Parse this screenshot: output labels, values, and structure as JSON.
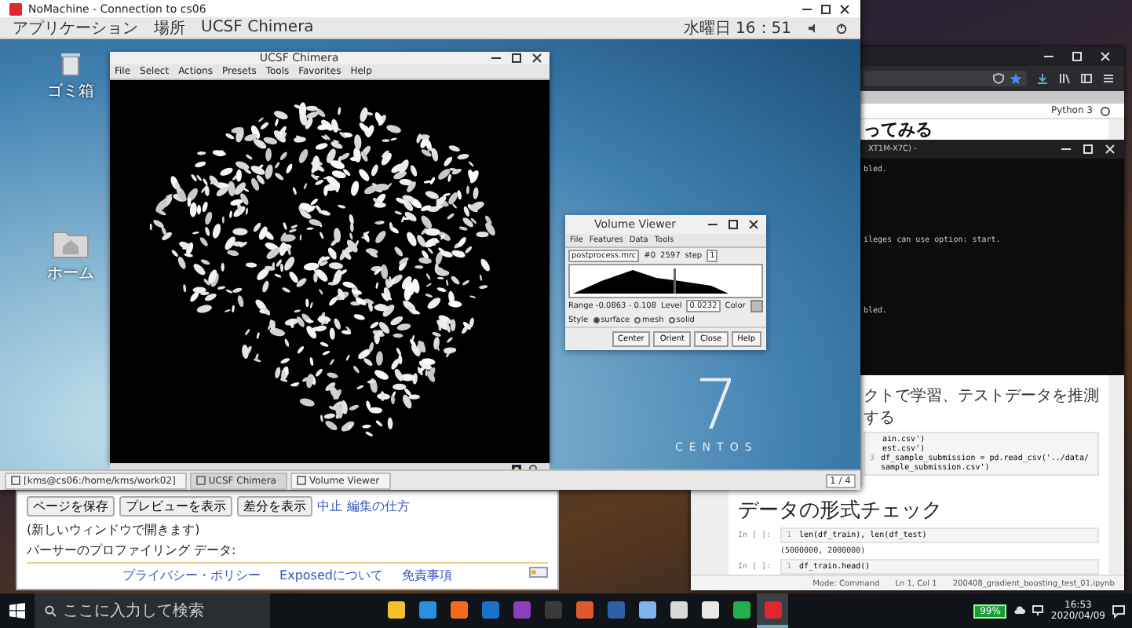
{
  "host_window": {
    "title": "NoMachine - Connection to cs06"
  },
  "gnome_bar": {
    "menus": [
      "アプリケーション",
      "場所",
      "UCSF Chimera"
    ],
    "clock": "水曜日 16：51"
  },
  "desktop_icons": [
    {
      "label": "ゴミ箱",
      "kind": "trash"
    },
    {
      "label": "ホーム",
      "kind": "folder"
    }
  ],
  "chimera": {
    "title": "UCSF Chimera",
    "menus": [
      "File",
      "Select",
      "Actions",
      "Presets",
      "Tools",
      "Favorites",
      "Help"
    ]
  },
  "volume_viewer": {
    "title": "Volume Viewer",
    "menus": [
      "File",
      "Features",
      "Data",
      "Tools"
    ],
    "file": "postprocess.mrc",
    "model": "#0",
    "size": "2597",
    "step_label": "step",
    "step": "1",
    "range": "Range -0.0863 - 0.108",
    "level_label": "Level",
    "level": "0.0232",
    "color_label": "Color",
    "style_label": "Style",
    "styles": [
      {
        "label": "surface",
        "selected": true
      },
      {
        "label": "mesh",
        "selected": false
      },
      {
        "label": "solid",
        "selected": false
      }
    ],
    "buttons": [
      "Center",
      "Orient",
      "Close",
      "Help"
    ]
  },
  "os_logo": {
    "number": "7",
    "name": "CENTOS"
  },
  "gnome_taskbar": {
    "items": [
      {
        "label": "[kms@cs06:/home/kms/work02]",
        "selected": false
      },
      {
        "label": "UCSF Chimera",
        "selected": true
      },
      {
        "label": "Volume Viewer",
        "selected": false
      }
    ],
    "pager": "1 / 4"
  },
  "wiki_editor": {
    "buttons": [
      "ページを保存",
      "プレビューを表示",
      "差分を表示"
    ],
    "cancel_link": "中止",
    "help_link": "編集の仕方",
    "help_note": "(新しいウィンドウで開きます)",
    "profiling": "パーサーのプロファイリング データ:",
    "footer_links": [
      "プライバシー・ポリシー",
      "Exposedについて",
      "免責事項"
    ]
  },
  "notebook": {
    "kernel": "Python 3",
    "heading": "ってみる",
    "intro": "クトで学習、テストデータを推測する",
    "cell_lines": [
      {
        "code": "ain.csv')"
      },
      {
        "code": "est.csv')"
      },
      {
        "number": "3",
        "code": "df_sample_submission = pd.read_csv('../data/sample_submission.csv')"
      }
    ],
    "section": "データの形式チェック",
    "cells": [
      {
        "prompt": "In [ ]:",
        "number": "1",
        "code": "len(df_train), len(df_test)",
        "output": "(5000000, 2000000)"
      },
      {
        "prompt": "In [ ]:",
        "number": "1",
        "code": "df_train.head()"
      }
    ],
    "status": {
      "mode": "Mode: Command",
      "position": "Ln 1, Col 1",
      "file": "200408_gradient_boosting_test_01.ipynb"
    }
  },
  "terminal": {
    "title": "XT1M-X7C) -",
    "lines": [
      "bled.",
      "ileges can use option: start.",
      "bled."
    ]
  },
  "taskbar": {
    "search_placeholder": "ここに入力して検索",
    "apps": [
      {
        "color": "#f2c12e",
        "selected": false
      },
      {
        "color": "#2b8fe0",
        "selected": false
      },
      {
        "color": "#f26b1d",
        "selected": false
      },
      {
        "color": "#1a73c9",
        "selected": false
      },
      {
        "color": "#8b3fb8",
        "selected": false
      },
      {
        "color": "#3a3a3a",
        "selected": false
      },
      {
        "color": "#e0582b",
        "selected": false
      },
      {
        "color": "#2f5fa8",
        "selected": false
      },
      {
        "color": "#7fb4e8",
        "selected": false
      },
      {
        "color": "#d8d8d8",
        "selected": false
      },
      {
        "color": "#e8e8e8",
        "selected": false
      },
      {
        "color": "#21b14c",
        "selected": false
      },
      {
        "color": "#e0262e",
        "selected": true
      }
    ],
    "battery": "99%",
    "time": "16:53",
    "date": "2020/04/09"
  }
}
